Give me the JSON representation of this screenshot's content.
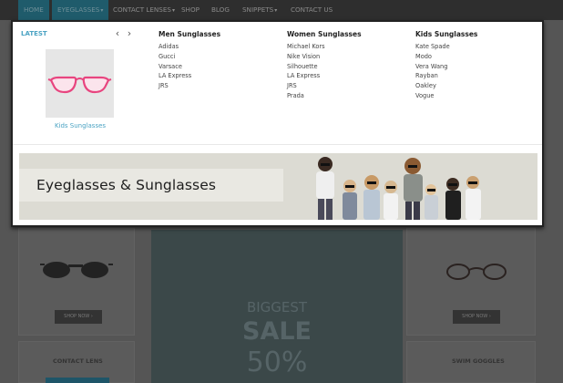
{
  "nav": {
    "items": [
      {
        "label": "HOME",
        "active": true,
        "caret": false
      },
      {
        "label": "EYEGLASSES",
        "active": true,
        "caret": true
      },
      {
        "label": "CONTACT LENSES",
        "active": false,
        "caret": true
      },
      {
        "label": "SHOP",
        "active": false,
        "caret": false
      },
      {
        "label": "BLOG",
        "active": false,
        "caret": false
      },
      {
        "label": "SNIPPETS",
        "active": false,
        "caret": true
      },
      {
        "label": "CONTACT US",
        "active": false,
        "caret": false
      }
    ]
  },
  "dropdown": {
    "latest": {
      "heading": "LATEST",
      "product_caption": "Kids Sunglasses",
      "prev_icon": "chevron-left-icon",
      "next_icon": "chevron-right-icon"
    },
    "columns": [
      {
        "title": "Men Sunglasses",
        "items": [
          "Adidas",
          "Gucci",
          "Varsace",
          "LA Express",
          "JRS"
        ]
      },
      {
        "title": "Women Sunglasses",
        "items": [
          "Michael Kors",
          "Nike Vision",
          "Silhouette",
          "LA Express",
          "JRS",
          "Prada"
        ]
      },
      {
        "title": "Kids Sunglasses",
        "items": [
          "Kate Spade",
          "Modo",
          "Vera Wang",
          "Rayban",
          "Oakley",
          "Vogue"
        ]
      }
    ],
    "banner": {
      "text": "Eyeglasses & Sunglasses"
    }
  },
  "background": {
    "shop_now_left": "SHOP NOW ›",
    "shop_now_right": "SHOP NOW ›",
    "contact_lens_title": "CONTACT LENS",
    "swim_goggles_title": "SWIM GOGGLES",
    "promo_line1": "BIGGEST",
    "promo_line2": "SALE",
    "promo_line3": "50%"
  },
  "colors": {
    "accent": "#4ba3c3",
    "nav_bg": "#2e2e2e",
    "nav_active": "#1f5b6b",
    "dropdown_bg": "#ffffff",
    "frame_color": "#e8457f"
  }
}
